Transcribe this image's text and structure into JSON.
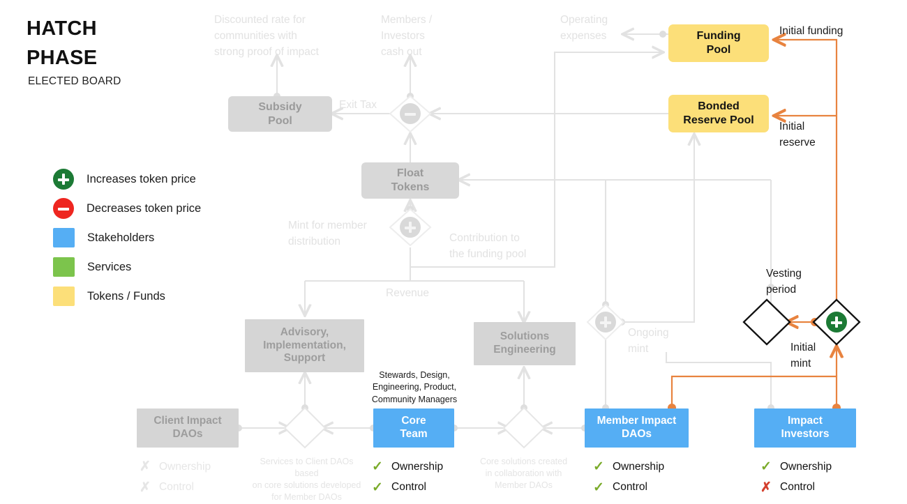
{
  "header": {
    "title_line1": "HATCH",
    "title_line2": "PHASE",
    "subtitle": "ELECTED BOARD"
  },
  "legend": {
    "items": [
      {
        "icon": "plus-circle-icon",
        "label": "Increases token price",
        "color": "#1c7a35"
      },
      {
        "icon": "minus-circle-icon",
        "label": "Decreases token price",
        "color": "#ee2620"
      },
      {
        "icon": "color-swatch",
        "label": "Stakeholders",
        "color": "#55aef4"
      },
      {
        "icon": "color-swatch",
        "label": "Services",
        "color": "#7cc44c"
      },
      {
        "icon": "color-swatch",
        "label": "Tokens / Funds",
        "color": "#fcdf79"
      }
    ]
  },
  "nodes": {
    "subsidy_pool": "Subsidy\nPool",
    "float_tokens": "Float\nTokens",
    "funding_pool": "Funding\nPool",
    "bonded_reserve_pool": "Bonded\nReserve Pool",
    "advisory": "Advisory,\nImplementation,\nSupport",
    "solutions_engineering": "Solutions\nEngineering",
    "client_impact_daos": "Client Impact\nDAOs",
    "core_team": "Core\nTeam",
    "member_impact_daos": "Member Impact\nDAOs",
    "impact_investors": "Impact\nInvestors"
  },
  "annotations": {
    "discounted_rate": "Discounted rate for\ncommunities with\nstrong proof of impact",
    "members_cash_out": "Members  /\nInvestors\ncash out",
    "operating_expenses": "Operating\nexpenses",
    "initial_funding": "Initial funding",
    "initial_reserve": "Initial\nreserve",
    "exit_tax": "Exit Tax",
    "mint_for_member": "Mint for member\ndistribution",
    "contribution_to_pool": "Contribution to\nthe funding pool",
    "revenue": "Revenue",
    "ongoing_mint": "Ongoing\nmint",
    "vesting_period": "Vesting\nperiod",
    "initial_mint": "Initial\nmint",
    "core_team_roles": "Stewards, Design,\nEngineering, Product,\nCommunity Managers",
    "services_to_client_daos": "Services to Client DAOs based\non core solutions developed\nfor Member DAOs",
    "core_solutions_created": "Core solutions created\nin collaboration with\nMember DAOs"
  },
  "ownership_control": {
    "ownership_label": "Ownership",
    "control_label": "Control",
    "check_glyph": "✓",
    "x_glyph": "✗",
    "client_impact_daos": {
      "ownership": "x",
      "control": "x",
      "style": "faint"
    },
    "core_team": {
      "ownership": "check",
      "control": "check",
      "style": "dark"
    },
    "member_impact_daos": {
      "ownership": "check",
      "control": "check",
      "style": "dark"
    },
    "impact_investors": {
      "ownership": "check",
      "control": "x",
      "style": "dark"
    }
  },
  "colors": {
    "orange": "#e8833f",
    "faint_gray": "#e4e4e4",
    "green": "#1c7a35",
    "red": "#ee2620",
    "yellow": "#fcdf79",
    "blue": "#55aef4",
    "gray_node": "#d8d8d8"
  }
}
